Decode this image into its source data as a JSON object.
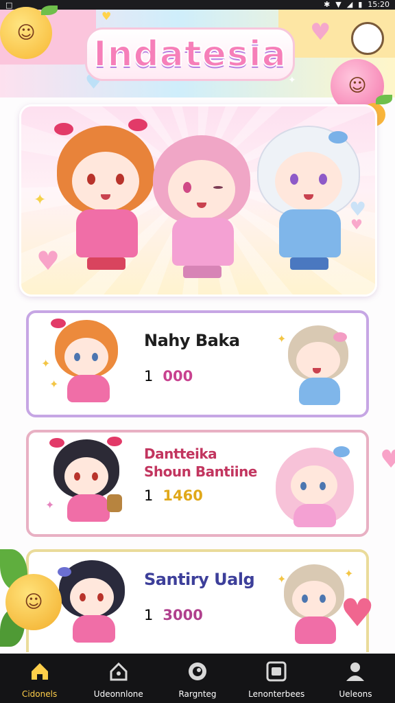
{
  "status_bar": {
    "time": "15:20"
  },
  "header": {
    "title": "Indatesia"
  },
  "cards": [
    {
      "name": "Nahy Baka",
      "rank": "1",
      "score": "000",
      "name_color": "#9a4a14",
      "score_color": "#c8428f",
      "border": "#c6a6e4"
    },
    {
      "name": "Dantteika Shoun Bantiine",
      "rank": "1",
      "score": "1460",
      "name_color": "#c2355f",
      "score_color": "#e0a81a",
      "border": "#e8b0c3"
    },
    {
      "name": "Santiry Ualg",
      "rank": "1",
      "score": "3000",
      "name_color": "#3d3f9a",
      "score_color": "#b0408d",
      "border": "#eadb9a"
    }
  ],
  "nav": {
    "items": [
      {
        "label": "Cidonels",
        "icon": "home-icon",
        "active": true
      },
      {
        "label": "Udeonnlone",
        "icon": "house-outline-icon",
        "active": false
      },
      {
        "label": "Rargnteg",
        "icon": "camera-icon",
        "active": false
      },
      {
        "label": "Lenonterbees",
        "icon": "gamepad-icon",
        "active": false
      },
      {
        "label": "Ueleons",
        "icon": "profile-icon",
        "active": false
      }
    ]
  },
  "colors": {
    "accent": "#f67fb9",
    "nav_bg": "#141416",
    "nav_active": "#ffcf4a"
  }
}
